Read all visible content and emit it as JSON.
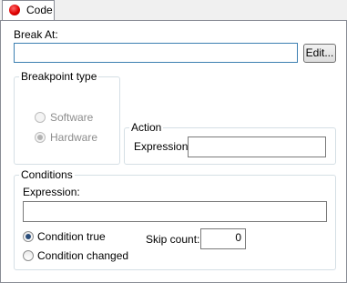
{
  "tab": {
    "label": "Code"
  },
  "break_at": {
    "label": "Break At:",
    "value": "",
    "edit_button": "Edit..."
  },
  "breakpoint_type": {
    "title": "Breakpoint type",
    "software": "Software",
    "hardware": "Hardware",
    "selected": "hardware",
    "enabled": false
  },
  "action": {
    "title": "Action",
    "expression_label": "Expression:",
    "expression_value": ""
  },
  "conditions": {
    "title": "Conditions",
    "expression_label": "Expression:",
    "expression_value": "",
    "condition_true": "Condition true",
    "condition_changed": "Condition changed",
    "selected": "condition_true",
    "skip_count_label": "Skip count:",
    "skip_count_value": "0"
  },
  "colors": {
    "tab_dot": "#e00000",
    "focus_border": "#3c7fb1",
    "group_border": "#d5dfe5"
  }
}
